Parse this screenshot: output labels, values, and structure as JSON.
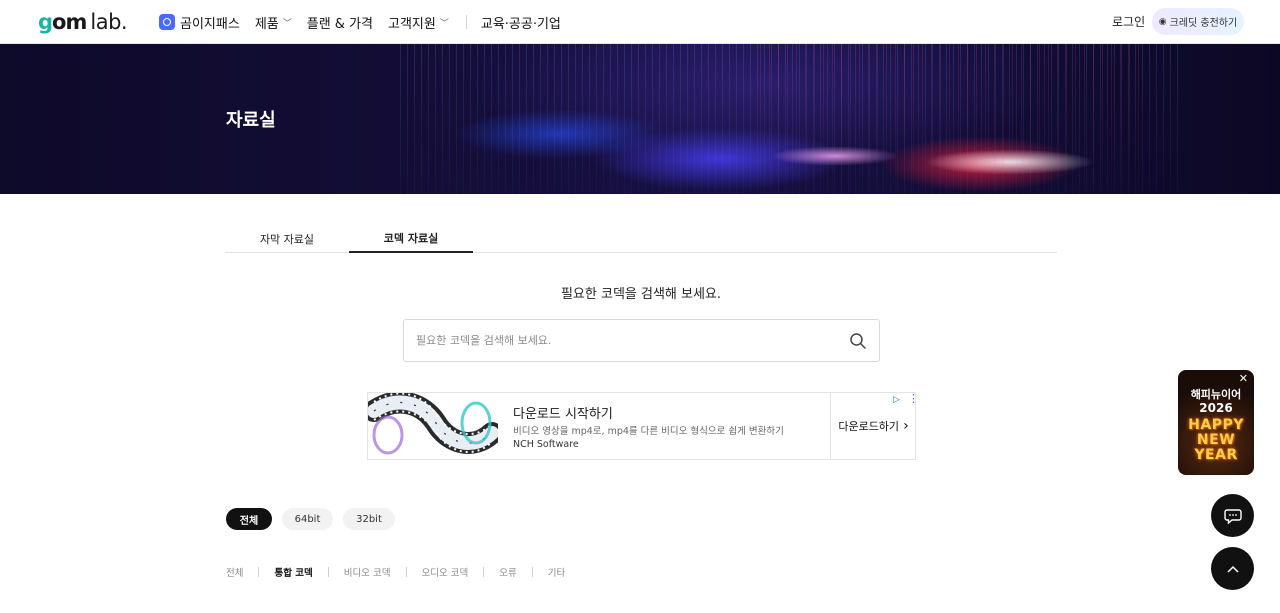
{
  "header": {
    "logo": {
      "main": "gom",
      "suffix": "lab."
    },
    "nav": [
      {
        "label": "곰이지패스",
        "dropdown": false
      },
      {
        "label": "제품",
        "dropdown": true
      },
      {
        "label": "플랜 & 가격",
        "dropdown": false
      },
      {
        "label": "고객지원",
        "dropdown": true
      },
      {
        "label": "교육·공공·기업",
        "dropdown": false
      }
    ],
    "login_label": "로그인",
    "credit_label": "크레딧 충전하기"
  },
  "hero": {
    "title": "자료실"
  },
  "tabs": [
    {
      "label": "자막 자료실",
      "active": false
    },
    {
      "label": "코덱 자료실",
      "active": true
    }
  ],
  "search": {
    "heading": "필요한 코덱을 검색해 보세요.",
    "placeholder": "필요한 코덱을 검색해 보세요."
  },
  "ad": {
    "title": "다운로드 시작하기",
    "description": "비디오 영상을 mp4로, mp4를 다른 비디오 형식으로 쉽게 변환하기",
    "advertiser": "NCH Software",
    "cta": "다운로드하기"
  },
  "filters": {
    "bits": [
      {
        "label": "전체",
        "active": true
      },
      {
        "label": "64bit",
        "active": false
      },
      {
        "label": "32bit",
        "active": false
      }
    ],
    "categories": [
      {
        "label": "전체",
        "active": false
      },
      {
        "label": "통합 코덱",
        "active": true
      },
      {
        "label": "비디오 코덱",
        "active": false
      },
      {
        "label": "오디오 코덱",
        "active": false
      },
      {
        "label": "오류",
        "active": false
      },
      {
        "label": "기타",
        "active": false
      }
    ]
  },
  "promo": {
    "title": "해피뉴이어",
    "year": "2026",
    "art_line1": "HAPPY",
    "art_line2": "NEW",
    "art_line3": "YEAR"
  },
  "colors": {
    "accent": "#111111",
    "logo_teal": "#19b5a5",
    "gomi_blue": "#4a6bff",
    "ad_blue": "#1a73e8"
  }
}
